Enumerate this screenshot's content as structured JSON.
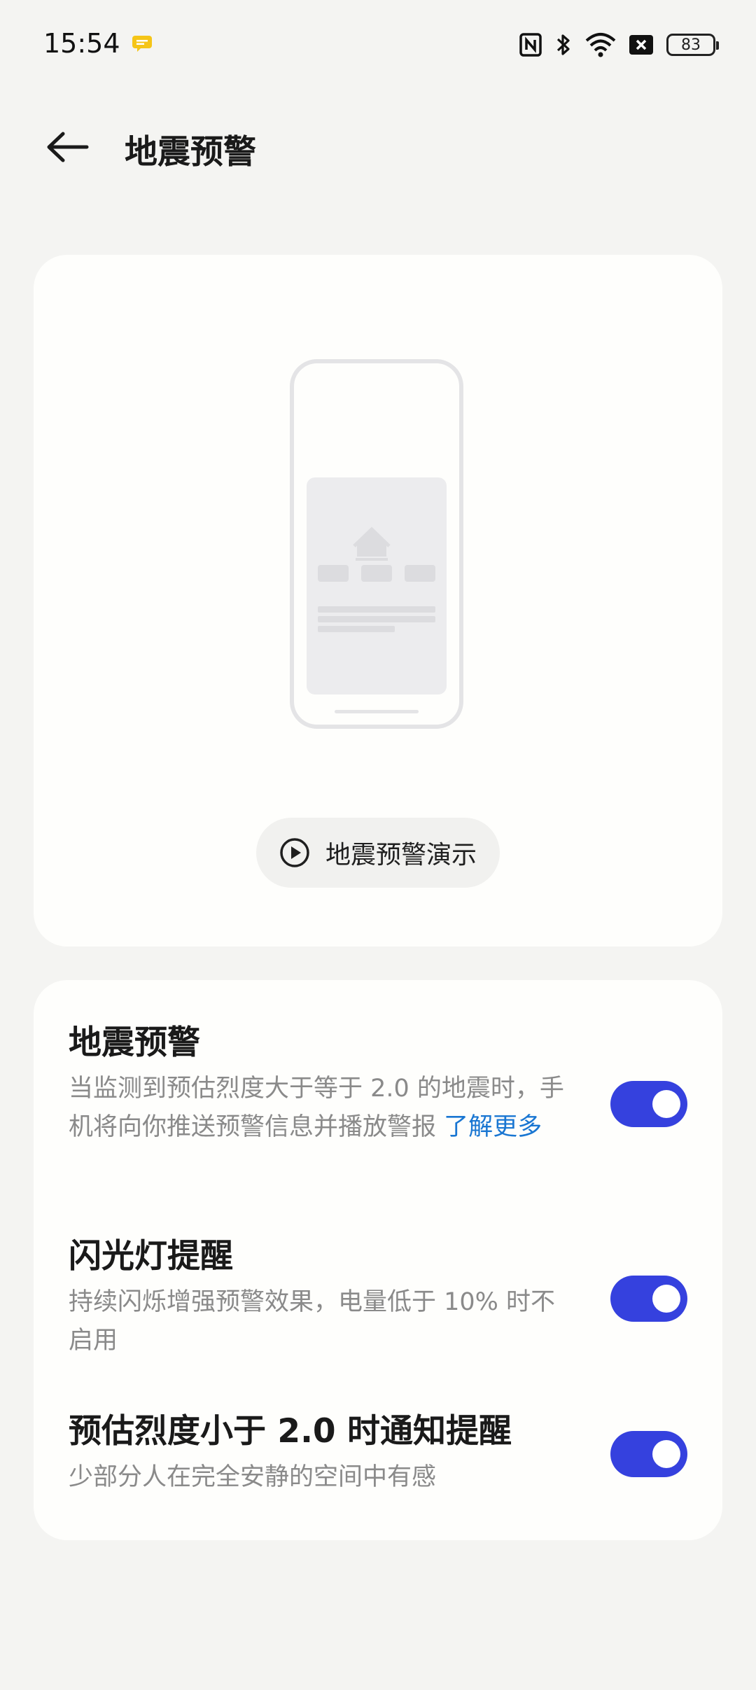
{
  "status_bar": {
    "time": "15:54",
    "battery": "83",
    "icons": [
      "notification-icon",
      "nfc-icon",
      "bluetooth-icon",
      "wifi-icon",
      "no-sim-icon",
      "battery-icon"
    ]
  },
  "header": {
    "title": "地震预警",
    "back_icon": "back-arrow-icon"
  },
  "demo": {
    "button_label": "地震预警演示",
    "icon": "play-circle-icon"
  },
  "settings": [
    {
      "title": "地震预警",
      "desc": "当监测到预估烈度大于等于 2.0 的地震时，手机将向你推送预警信息并播放警报",
      "link": "了解更多",
      "enabled": true
    },
    {
      "title": "闪光灯提醒",
      "desc": "持续闪烁增强预警效果，电量低于 10% 时不启用",
      "enabled": true
    },
    {
      "title": "预估烈度小于 2.0 时通知提醒",
      "desc": "少部分人在完全安静的空间中有感",
      "enabled": true
    }
  ],
  "colors": {
    "accent": "#3541de",
    "link": "#1976d2",
    "background": "#f4f4f2",
    "card": "#fefefc"
  }
}
